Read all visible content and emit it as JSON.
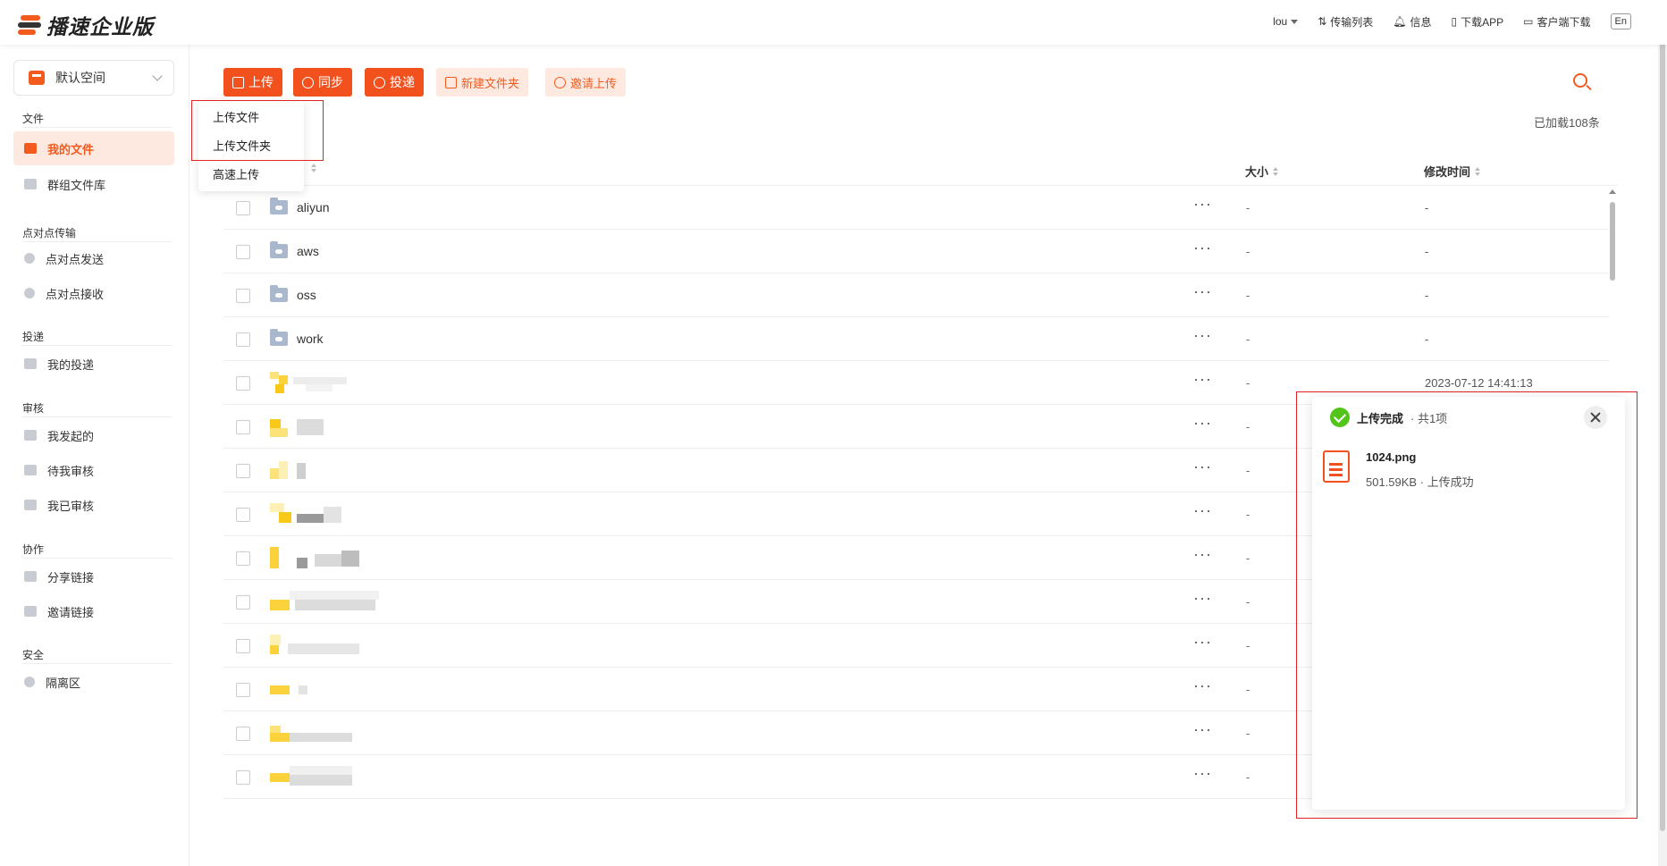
{
  "app": {
    "brand": "播速企业版"
  },
  "topbar": {
    "user": "lou",
    "transfer_list": "传输列表",
    "messages": "信息",
    "download_app": "下载APP",
    "client_download": "客户端下载",
    "lang": "En"
  },
  "sidebar": {
    "space_label": "默认空间",
    "sections": [
      {
        "title": "文件",
        "items": [
          "我的文件",
          "群组文件库"
        ]
      },
      {
        "title": "点对点传输",
        "items": [
          "点对点发送",
          "点对点接收"
        ]
      },
      {
        "title": "投递",
        "items": [
          "我的投递"
        ]
      },
      {
        "title": "审核",
        "items": [
          "我发起的",
          "待我审核",
          "我已审核"
        ]
      },
      {
        "title": "协作",
        "items": [
          "分享链接",
          "邀请链接"
        ]
      },
      {
        "title": "安全",
        "items": [
          "隔离区"
        ]
      }
    ],
    "active_item": "我的文件"
  },
  "toolbar": {
    "upload": "上传",
    "sync": "同步",
    "deliver": "投递",
    "new_folder": "新建文件夹",
    "invite_upload": "邀请上传",
    "loaded_count": "已加载108条"
  },
  "upload_menu": [
    "上传文件",
    "上传文件夹",
    "高速上传"
  ],
  "table": {
    "columns": {
      "size": "大小",
      "modified": "修改时间"
    },
    "rows": [
      {
        "name": "aliyun",
        "size": "-",
        "modified": "-"
      },
      {
        "name": "aws",
        "size": "-",
        "modified": "-"
      },
      {
        "name": "oss",
        "size": "-",
        "modified": "-"
      },
      {
        "name": "work",
        "size": "-",
        "modified": "-"
      },
      {
        "name": "",
        "size": "-",
        "modified": "2023-07-12 14:41:13"
      },
      {
        "name": "",
        "size": "-",
        "modified": ""
      },
      {
        "name": "",
        "size": "-",
        "modified": ""
      },
      {
        "name": "",
        "size": "-",
        "modified": ""
      },
      {
        "name": "",
        "size": "-",
        "modified": ""
      },
      {
        "name": "",
        "size": "-",
        "modified": ""
      },
      {
        "name": "",
        "size": "-",
        "modified": ""
      },
      {
        "name": "",
        "size": "-",
        "modified": ""
      },
      {
        "name": "",
        "size": "-",
        "modified": ""
      },
      {
        "name": "",
        "size": "-",
        "modified": ""
      }
    ],
    "more_label": "···"
  },
  "upload_panel": {
    "title": "上传完成",
    "count": "· 共1项",
    "file_name": "1024.png",
    "file_meta": "501.59KB · 上传成功"
  },
  "colors": {
    "accent": "#f2511e",
    "success": "#52c41a",
    "highlight_box": "#e02424"
  }
}
